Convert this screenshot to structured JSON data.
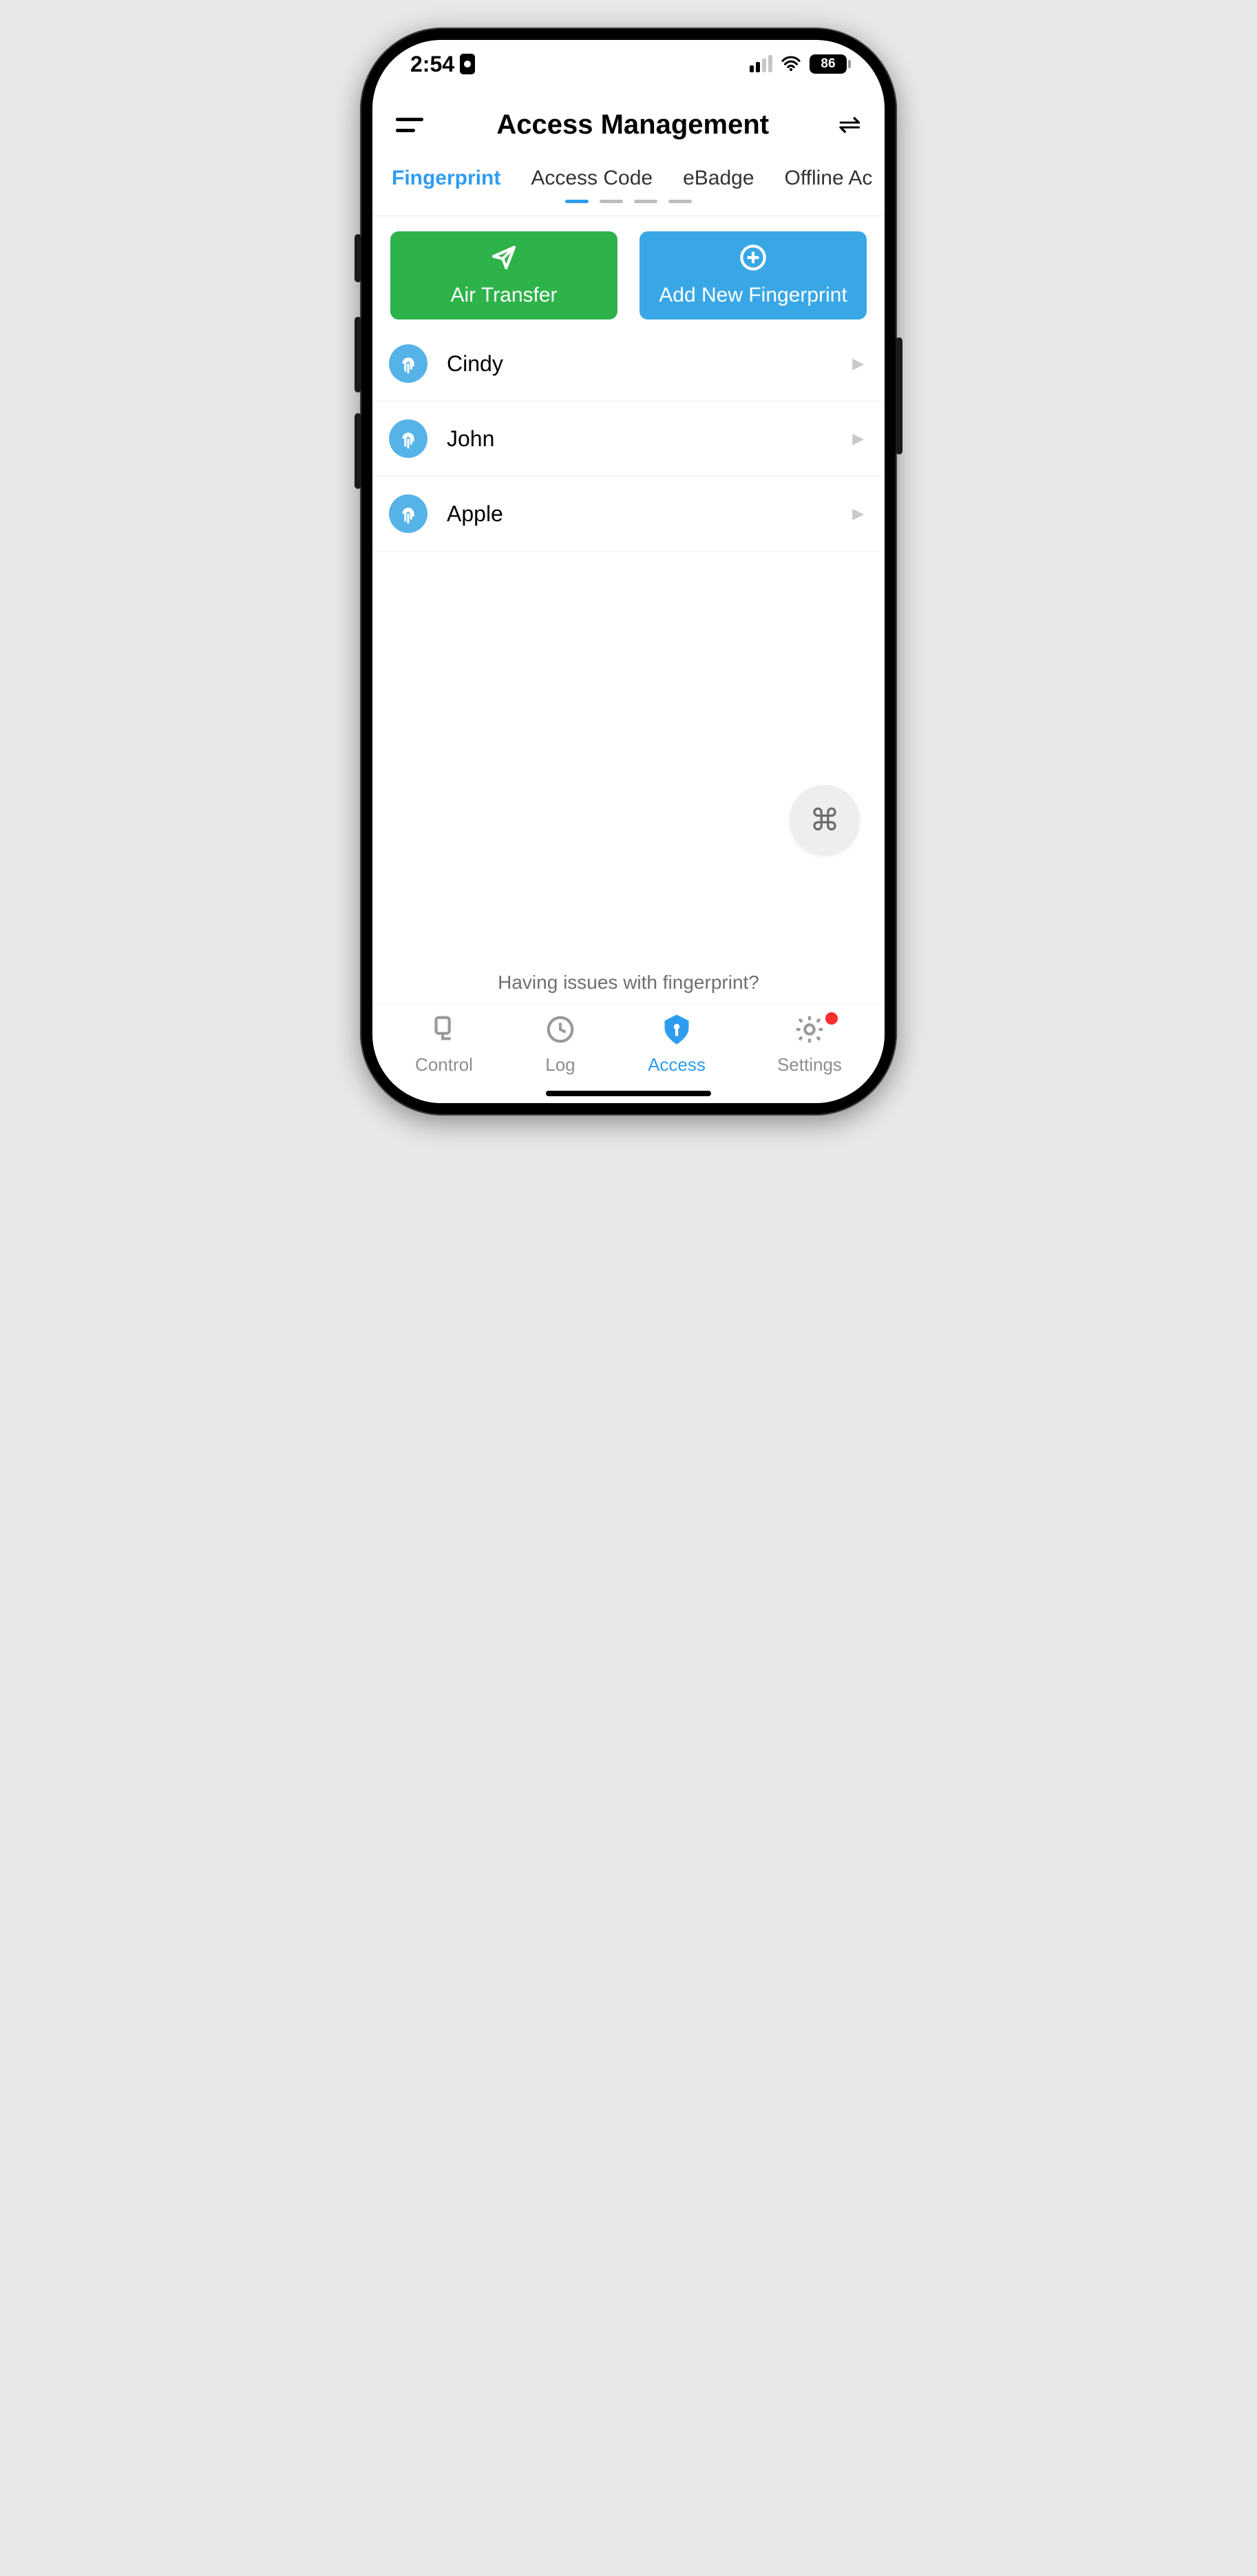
{
  "status": {
    "time": "2:54",
    "battery": "86"
  },
  "header": {
    "title": "Access Management"
  },
  "tabs": {
    "items": [
      {
        "label": "Fingerprint"
      },
      {
        "label": "Access Code"
      },
      {
        "label": "eBadge"
      },
      {
        "label": "Offline Ac"
      }
    ],
    "active_index": 0,
    "page_indicator_count": 4,
    "page_indicator_active": 0
  },
  "actions": {
    "air_transfer": "Air Transfer",
    "add_fingerprint": "Add New Fingerprint"
  },
  "fingerprints": [
    {
      "name": "Cindy"
    },
    {
      "name": "John"
    },
    {
      "name": "Apple"
    }
  ],
  "help_text": "Having issues with fingerprint?",
  "nav": {
    "items": [
      {
        "label": "Control"
      },
      {
        "label": "Log"
      },
      {
        "label": "Access"
      },
      {
        "label": "Settings"
      }
    ],
    "active_index": 2,
    "settings_badge": true
  },
  "colors": {
    "accent": "#2e9df0",
    "green": "#2eb24a",
    "blue_btn": "#39a7e6",
    "badge_red": "#ff2d2d"
  }
}
